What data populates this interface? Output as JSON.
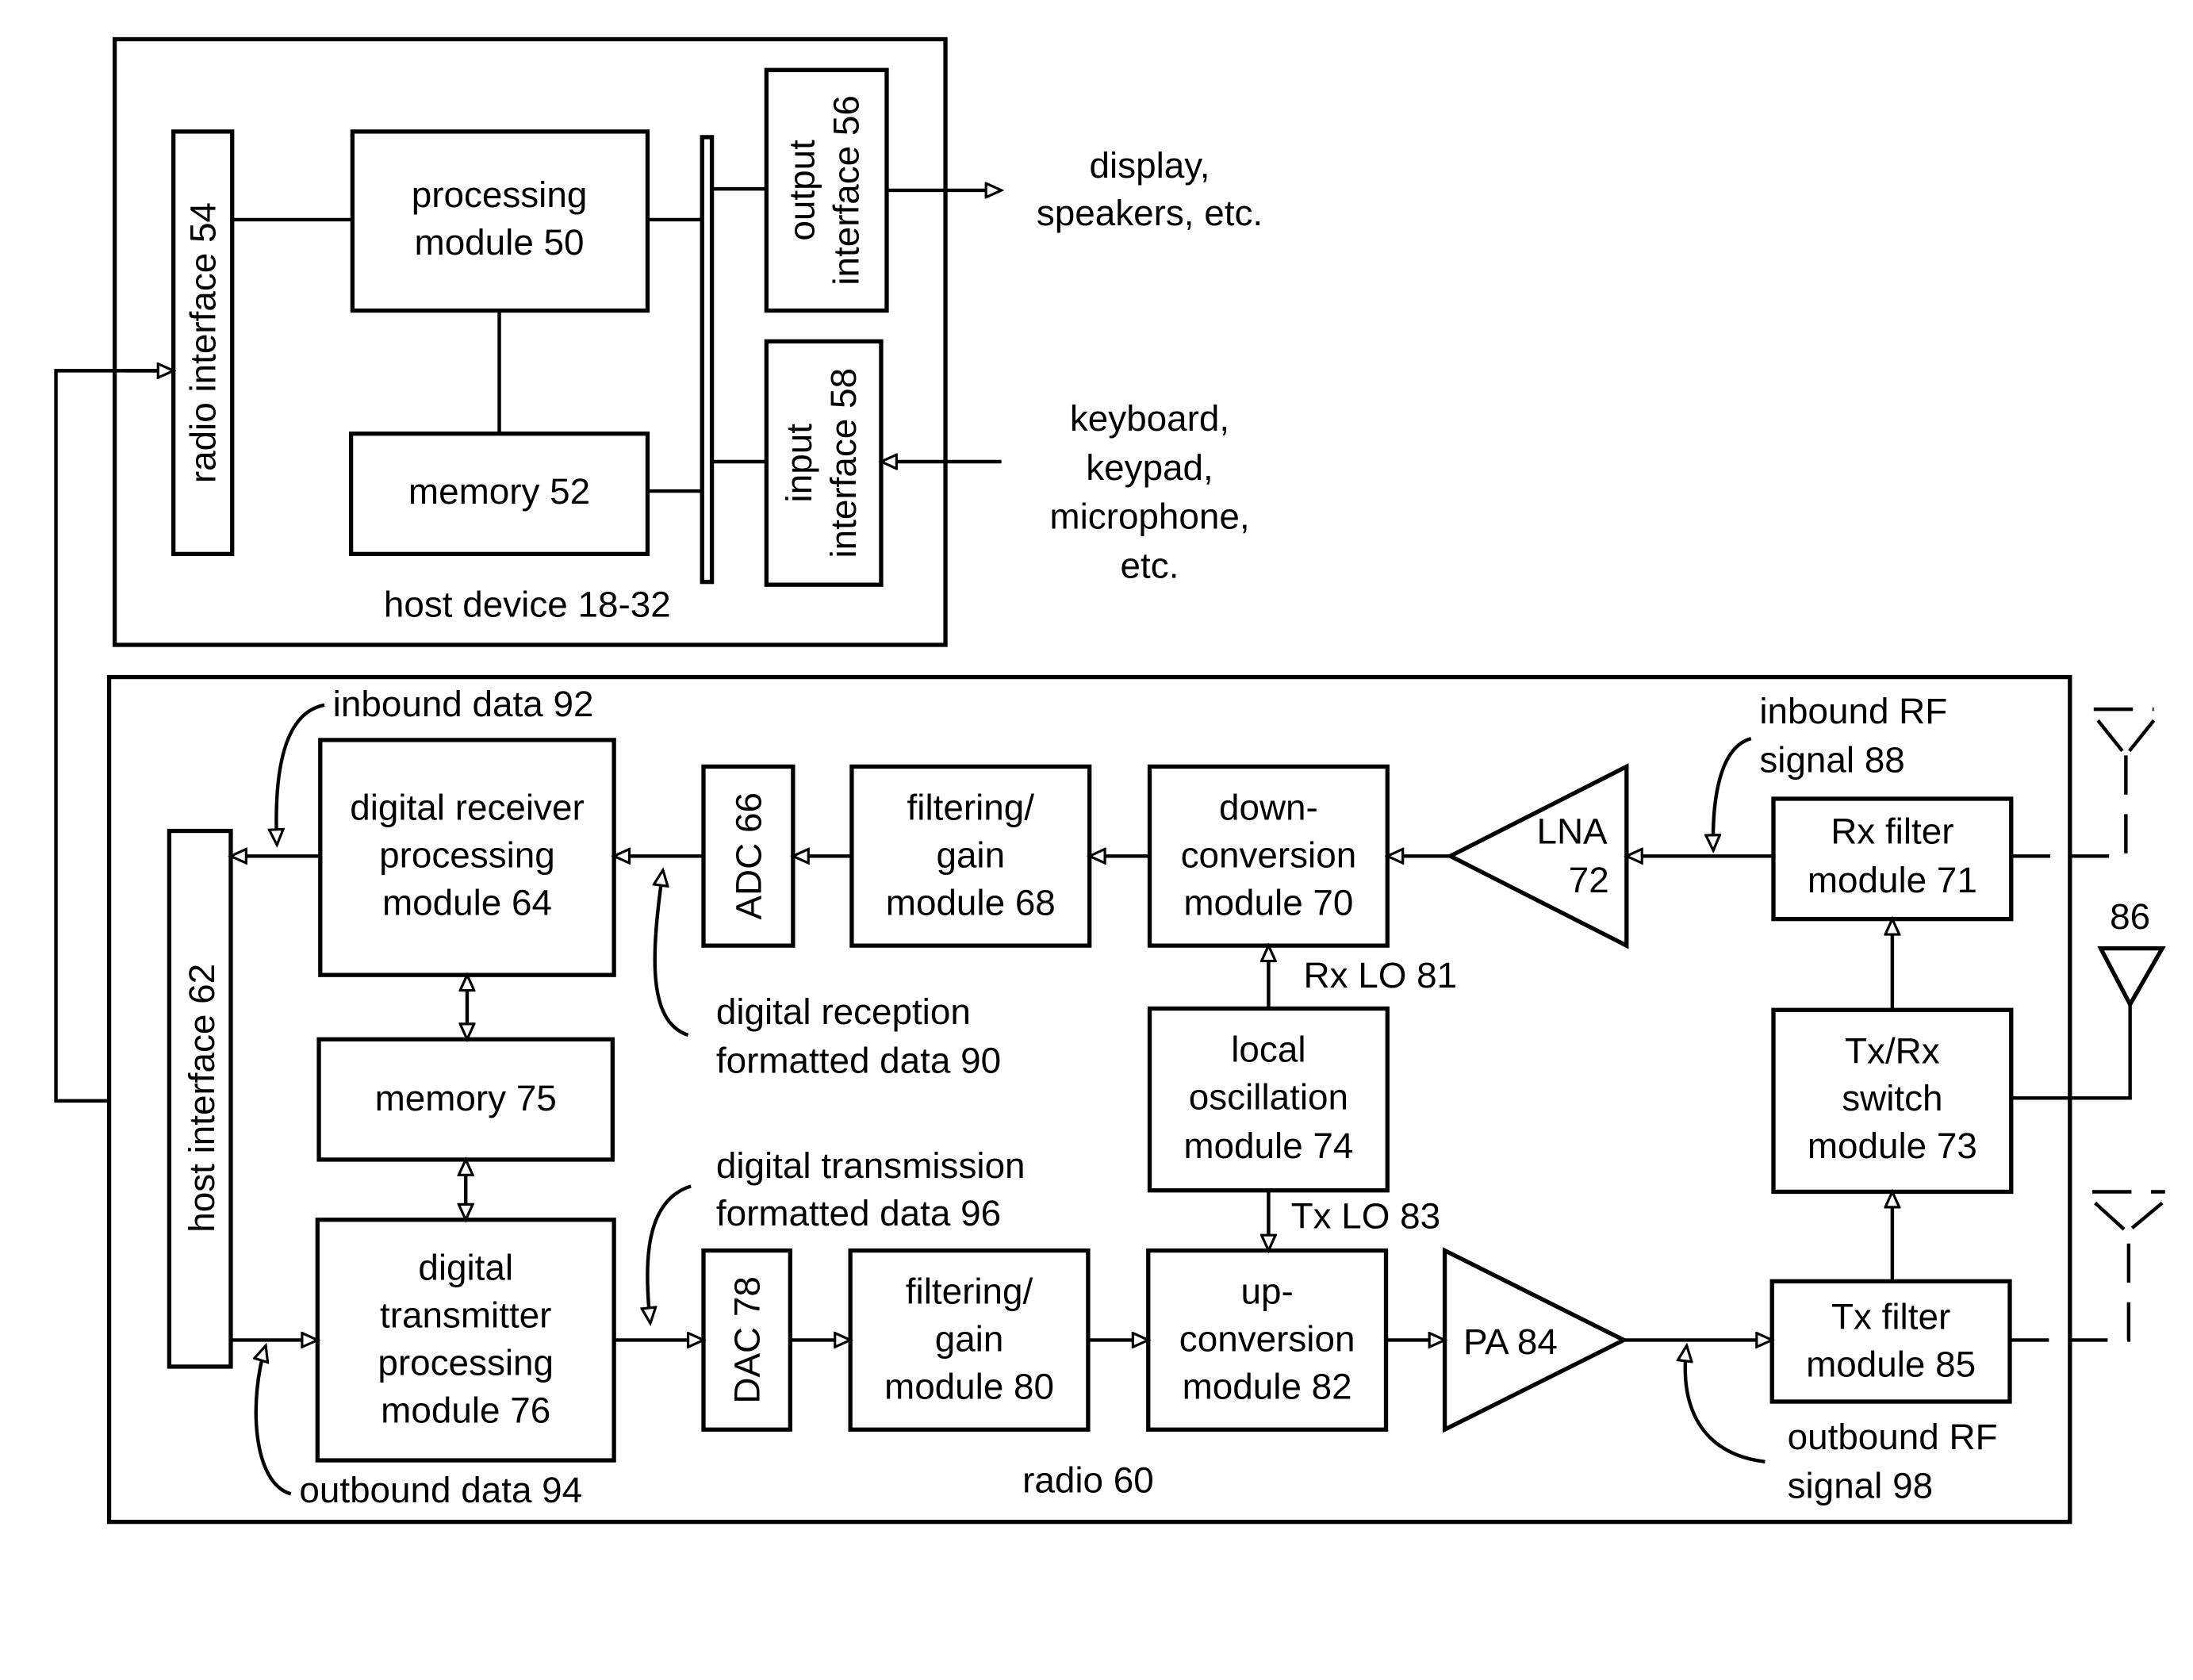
{
  "host": {
    "label": "host device 18-32",
    "radio_interface": "radio interface 54",
    "processing": [
      "processing",
      "module 50"
    ],
    "memory": "memory 52",
    "output_interface": [
      "output",
      "interface 56"
    ],
    "input_interface": [
      "input",
      "interface 58"
    ],
    "outputs_label": [
      "display,",
      "speakers, etc."
    ],
    "inputs_label": [
      "keyboard,",
      "keypad,",
      "microphone,",
      "etc."
    ]
  },
  "radio": {
    "label": "radio 60",
    "host_interface": "host interface 62",
    "digital_rx": [
      "digital receiver",
      "processing",
      "module 64"
    ],
    "memory": "memory 75",
    "digital_tx": [
      "digital",
      "transmitter",
      "processing",
      "module 76"
    ],
    "adc": "ADC 66",
    "dac": "DAC 78",
    "filter_rx": [
      "filtering/",
      "gain",
      "module 68"
    ],
    "filter_tx": [
      "filtering/",
      "gain",
      "module 80"
    ],
    "down_conv": [
      "down-",
      "conversion",
      "module 70"
    ],
    "up_conv": [
      "up-",
      "conversion",
      "module 82"
    ],
    "lo": [
      "local",
      "oscillation",
      "module 74"
    ],
    "rx_lo": "Rx LO 81",
    "tx_lo": "Tx LO 83",
    "lna": [
      "LNA",
      "72"
    ],
    "pa": "PA 84",
    "rx_filter": [
      "Rx filter",
      "module 71"
    ],
    "txrx_switch": [
      "Tx/Rx",
      "switch",
      "module 73"
    ],
    "tx_filter": [
      "Tx filter",
      "module 85"
    ],
    "antenna": "86",
    "inbound_data": "inbound data 92",
    "outbound_data": "outbound data 94",
    "rx_formatted": [
      "digital reception",
      "formatted data 90"
    ],
    "tx_formatted": [
      "digital transmission",
      "formatted data 96"
    ],
    "inbound_rf": [
      "inbound RF",
      "signal 88"
    ],
    "outbound_rf": [
      "outbound RF",
      "signal 98"
    ]
  }
}
